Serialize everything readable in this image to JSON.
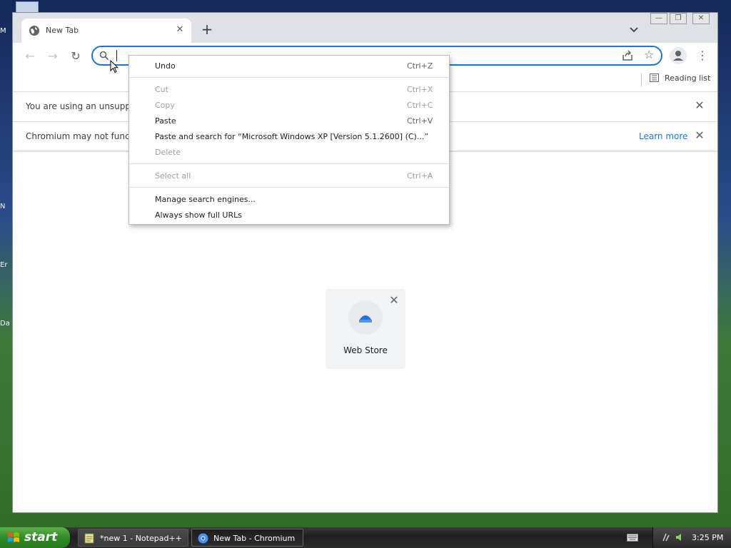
{
  "desktop": {
    "icon_fragments": [
      "M",
      "N",
      "Er",
      "Da"
    ]
  },
  "browser": {
    "tab": {
      "title": "New Tab",
      "favicon": "globe-icon"
    },
    "window_controls": [
      "minimize",
      "restore",
      "close"
    ],
    "omnibox": {
      "value": "",
      "placeholder": ""
    },
    "reading_list_label": "Reading list",
    "infobars": [
      {
        "text": "You are using an unsupported",
        "link": ""
      },
      {
        "text": "Chromium may not function",
        "link": "Learn more"
      }
    ],
    "tile": {
      "label": "Web Store"
    },
    "accent_color": "#1a73e8"
  },
  "context_menu": {
    "groups": [
      [
        {
          "label": "Undo",
          "shortcut": "Ctrl+Z",
          "enabled": true
        }
      ],
      [
        {
          "label": "Cut",
          "shortcut": "Ctrl+X",
          "enabled": false
        },
        {
          "label": "Copy",
          "shortcut": "Ctrl+C",
          "enabled": false
        },
        {
          "label": "Paste",
          "shortcut": "Ctrl+V",
          "enabled": true
        },
        {
          "label": "Paste and search for “Microsoft Windows XP [Version 5.1.2600] (C)...”",
          "shortcut": "",
          "enabled": true
        },
        {
          "label": "Delete",
          "shortcut": "",
          "enabled": false
        }
      ],
      [
        {
          "label": "Select all",
          "shortcut": "Ctrl+A",
          "enabled": false
        }
      ],
      [
        {
          "label": "Manage search engines...",
          "shortcut": "",
          "enabled": true
        },
        {
          "label": "Always show full URLs",
          "shortcut": "",
          "enabled": true
        }
      ]
    ]
  },
  "taskbar": {
    "start_label": "start",
    "buttons": [
      {
        "label": "*new 1 - Notepad++",
        "icon": "notepad-icon",
        "active": false
      },
      {
        "label": "New Tab - Chromium",
        "icon": "chromium-icon",
        "active": true
      }
    ],
    "clock": "3:25 PM"
  }
}
